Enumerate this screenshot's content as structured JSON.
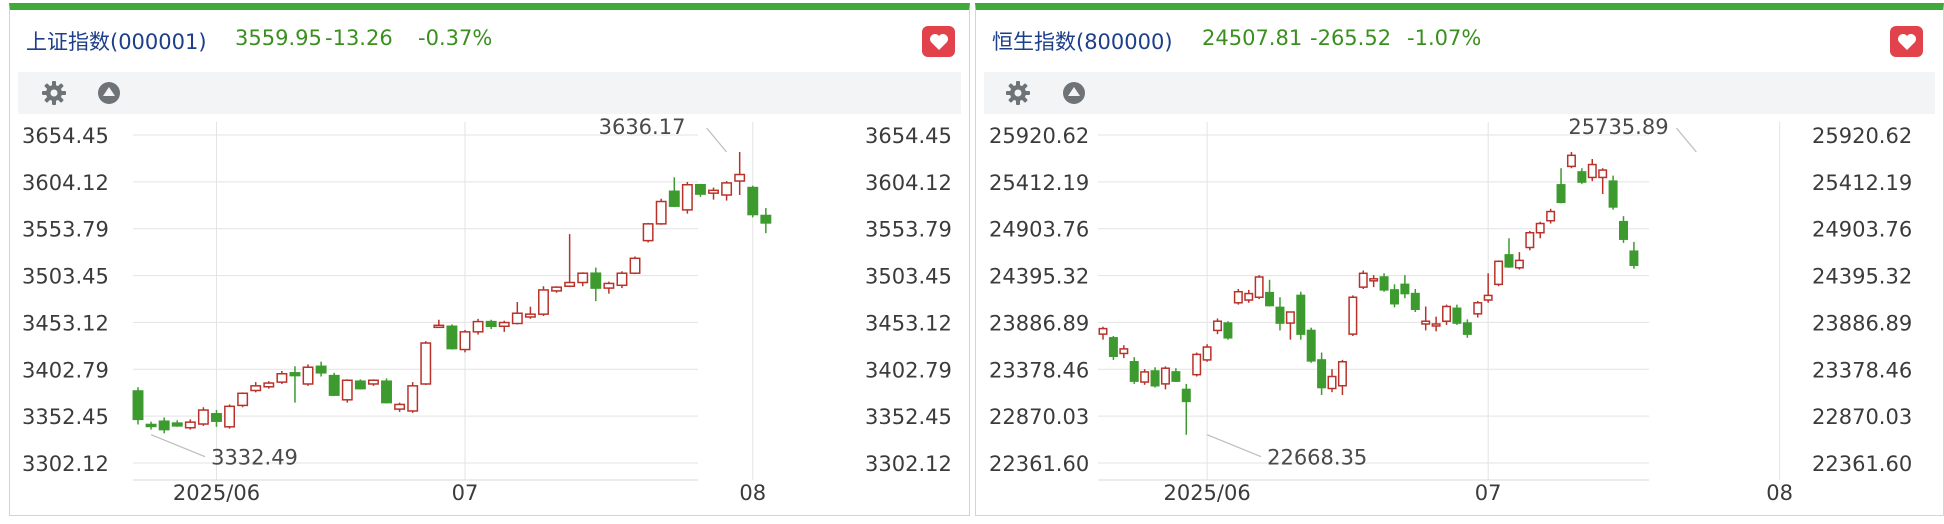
{
  "colors": {
    "up": "#b8322a",
    "down": "#3c9a2f",
    "brand": "#3faa3a",
    "grid": "#e3e3e3",
    "fav": "#e2424c"
  },
  "panels": [
    {
      "name": "上证指数(000001)",
      "price": "3559.95",
      "change": "-13.26",
      "pct": "-0.37%",
      "icons": {
        "settings": "gear-icon",
        "collapse": "triangle-up-icon",
        "favorite": "heart-icon"
      }
    },
    {
      "name": "恒生指数(800000)",
      "price": "24507.81",
      "change": "-265.52",
      "pct": "-1.07%",
      "icons": {
        "settings": "gear-icon",
        "collapse": "triangle-up-icon",
        "favorite": "heart-icon"
      }
    }
  ],
  "chart_data": [
    {
      "type": "candlestick",
      "title": "上证指数(000001)",
      "ylim": [
        3302.12,
        3654.45
      ],
      "yticks": [
        "3654.45",
        "3604.12",
        "3553.79",
        "3503.45",
        "3453.12",
        "3402.79",
        "3352.45",
        "3302.12"
      ],
      "xticks": [
        {
          "label": "2025/06",
          "index": 6
        },
        {
          "label": "07",
          "index": 25
        },
        {
          "label": "08",
          "index": 47
        }
      ],
      "annotations": [
        {
          "text": "3636.17",
          "index": 45,
          "value": 3636.17
        },
        {
          "text": "3332.49",
          "index": 1,
          "value": 3332.49
        }
      ],
      "grid": true,
      "candles": [
        [
          3379.5,
          3383.5,
          3343.5,
          3349.0
        ],
        [
          3343.5,
          3346.5,
          3338.0,
          3343.0
        ],
        [
          3347.0,
          3351.0,
          3334.0,
          3338.0
        ],
        [
          3345.0,
          3348.0,
          3341.0,
          3342.0
        ],
        [
          3340.0,
          3349.0,
          3338.0,
          3346.0
        ],
        [
          3344.0,
          3362.0,
          3342.0,
          3359.0
        ],
        [
          3355.0,
          3359.0,
          3341.0,
          3347.0
        ],
        [
          3341.0,
          3365.0,
          3339.0,
          3363.0
        ],
        [
          3364.0,
          3378.0,
          3362.0,
          3377.0
        ],
        [
          3380.0,
          3389.0,
          3378.0,
          3385.0
        ],
        [
          3384.0,
          3390.0,
          3382.0,
          3388.0
        ],
        [
          3389.0,
          3401.0,
          3387.0,
          3398.0
        ],
        [
          3399.0,
          3406.0,
          3367.0,
          3396.0
        ],
        [
          3387.0,
          3408.0,
          3385.0,
          3405.0
        ],
        [
          3406.0,
          3411.0,
          3395.0,
          3399.0
        ],
        [
          3396.0,
          3399.0,
          3374.0,
          3375.0
        ],
        [
          3370.0,
          3392.0,
          3367.0,
          3391.0
        ],
        [
          3390.0,
          3392.0,
          3381.0,
          3382.0
        ],
        [
          3387.0,
          3392.0,
          3385.0,
          3391.0
        ],
        [
          3390.0,
          3393.0,
          3366.0,
          3367.0
        ],
        [
          3360.0,
          3367.0,
          3357.0,
          3365.0
        ],
        [
          3358.0,
          3389.0,
          3356.0,
          3385.0
        ],
        [
          3387.0,
          3433.0,
          3386.0,
          3431.0
        ],
        [
          3449.0,
          3456.0,
          3448.0,
          3450.0
        ],
        [
          3449.0,
          3451.0,
          3424.0,
          3425.0
        ],
        [
          3424.0,
          3445.0,
          3421.0,
          3443.0
        ],
        [
          3443.0,
          3457.0,
          3440.0,
          3454.0
        ],
        [
          3454.0,
          3456.0,
          3446.0,
          3449.0
        ],
        [
          3449.0,
          3455.0,
          3443.0,
          3453.0
        ],
        [
          3452.0,
          3475.0,
          3451.0,
          3463.0
        ],
        [
          3459.0,
          3470.0,
          3457.0,
          3462.0
        ],
        [
          3462.0,
          3492.0,
          3460.0,
          3488.0
        ],
        [
          3487.0,
          3492.0,
          3485.0,
          3491.0
        ],
        [
          3492.0,
          3548.0,
          3491.0,
          3496.0
        ],
        [
          3496.0,
          3507.0,
          3492.0,
          3506.0
        ],
        [
          3506.0,
          3512.0,
          3476.0,
          3490.0
        ],
        [
          3490.0,
          3497.0,
          3484.0,
          3495.0
        ],
        [
          3493.0,
          3508.0,
          3490.0,
          3506.0
        ],
        [
          3506.0,
          3524.0,
          3505.0,
          3522.0
        ],
        [
          3541.0,
          3560.0,
          3539.0,
          3559.0
        ],
        [
          3559.0,
          3586.0,
          3558.0,
          3583.0
        ],
        [
          3594.0,
          3609.0,
          3577.0,
          3578.0
        ],
        [
          3574.0,
          3604.0,
          3570.0,
          3601.0
        ],
        [
          3601.0,
          3602.0,
          3588.0,
          3591.0
        ],
        [
          3592.0,
          3598.0,
          3585.0,
          3595.0
        ],
        [
          3590.0,
          3605.0,
          3584.0,
          3603.0
        ],
        [
          3605.0,
          3636.17,
          3590.0,
          3612.0
        ],
        [
          3598.0,
          3600.0,
          3566.0,
          3569.0
        ],
        [
          3568.0,
          3576.0,
          3549.0,
          3560.0
        ]
      ]
    },
    {
      "type": "candlestick",
      "title": "恒生指数(800000)",
      "ylim": [
        22361.6,
        25920.62
      ],
      "yticks": [
        "25920.62",
        "25412.19",
        "24903.76",
        "24395.32",
        "23886.89",
        "23378.46",
        "22870.03",
        "22361.60"
      ],
      "xticks": [
        {
          "label": "2025/06",
          "index": 10
        },
        {
          "label": "07",
          "index": 37
        },
        {
          "label": "08",
          "index": 65
        }
      ],
      "annotations": [
        {
          "text": "25735.89",
          "index": 57,
          "value": 25735.89
        },
        {
          "text": "22668.35",
          "index": 10,
          "value": 22668.35
        }
      ],
      "grid": true,
      "candles": [
        [
          23760,
          23840,
          23700,
          23820
        ],
        [
          23720,
          23740,
          23480,
          23520
        ],
        [
          23550,
          23640,
          23500,
          23600
        ],
        [
          23460,
          23510,
          23220,
          23250
        ],
        [
          23240,
          23380,
          23210,
          23350
        ],
        [
          23360,
          23400,
          23180,
          23200
        ],
        [
          23220,
          23410,
          23160,
          23390
        ],
        [
          23350,
          23390,
          23240,
          23250
        ],
        [
          23160,
          23220,
          22668.35,
          23030
        ],
        [
          23320,
          23560,
          23300,
          23540
        ],
        [
          23480,
          23650,
          23460,
          23620
        ],
        [
          23800,
          23930,
          23760,
          23900
        ],
        [
          23880,
          23900,
          23700,
          23720
        ],
        [
          24100,
          24250,
          24080,
          24220
        ],
        [
          24130,
          24240,
          24100,
          24200
        ],
        [
          24160,
          24400,
          24140,
          24380
        ],
        [
          24210,
          24350,
          24060,
          24070
        ],
        [
          24050,
          24160,
          23800,
          23880
        ],
        [
          23880,
          23920,
          23700,
          24000
        ],
        [
          24180,
          24220,
          23700,
          23760
        ],
        [
          23800,
          23830,
          23450,
          23470
        ],
        [
          23480,
          23560,
          23100,
          23180
        ],
        [
          23170,
          23380,
          23130,
          23300
        ],
        [
          23200,
          23480,
          23100,
          23460
        ],
        [
          23760,
          24180,
          23740,
          24160
        ],
        [
          24270,
          24450,
          24250,
          24420
        ],
        [
          24340,
          24400,
          24270,
          24360
        ],
        [
          24380,
          24420,
          24220,
          24240
        ],
        [
          24240,
          24300,
          24050,
          24090
        ],
        [
          24300,
          24400,
          24150,
          24200
        ],
        [
          24200,
          24250,
          24000,
          24030
        ],
        [
          23870,
          24060,
          23800,
          23900
        ],
        [
          23850,
          23950,
          23790,
          23870
        ],
        [
          23900,
          24080,
          23860,
          24060
        ],
        [
          24040,
          24080,
          23860,
          23880
        ],
        [
          23880,
          23920,
          23720,
          23760
        ],
        [
          23980,
          24120,
          23940,
          24100
        ],
        [
          24130,
          24420,
          24100,
          24180
        ],
        [
          24300,
          24560,
          24280,
          24550
        ],
        [
          24620,
          24800,
          24480,
          24490
        ],
        [
          24480,
          24650,
          24460,
          24560
        ],
        [
          24700,
          24880,
          24670,
          24860
        ],
        [
          24860,
          24980,
          24800,
          24960
        ],
        [
          24990,
          25120,
          24960,
          25090
        ],
        [
          25380,
          25560,
          25180,
          25190
        ],
        [
          25580,
          25735.89,
          25560,
          25700
        ],
        [
          25520,
          25560,
          25390,
          25410
        ],
        [
          25460,
          25660,
          25420,
          25600
        ],
        [
          25460,
          25560,
          25280,
          25540
        ],
        [
          25420,
          25480,
          25110,
          25140
        ],
        [
          24980,
          25040,
          24750,
          24790
        ],
        [
          24660,
          24760,
          24470,
          24507.81
        ]
      ]
    }
  ]
}
